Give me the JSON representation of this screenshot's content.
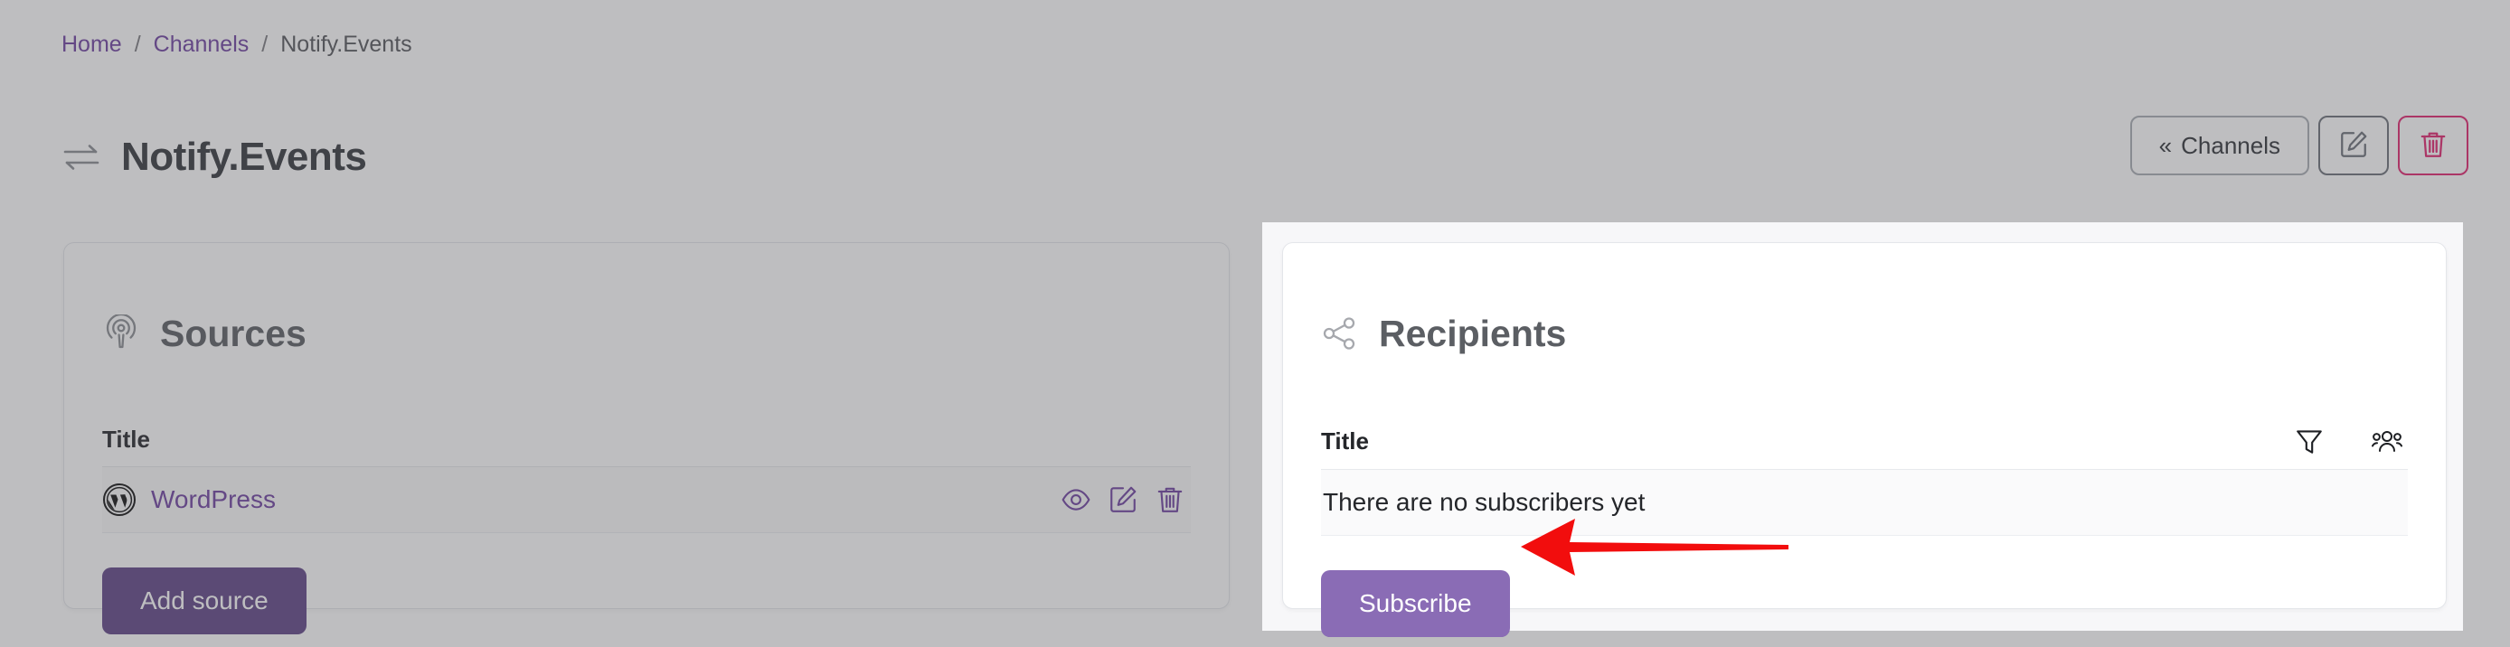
{
  "breadcrumb": {
    "items": [
      {
        "label": "Home",
        "type": "link"
      },
      {
        "label": "Channels",
        "type": "link"
      },
      {
        "label": "Notify.Events",
        "type": "current"
      }
    ],
    "separator": "/"
  },
  "header": {
    "title": "Notify.Events",
    "title_icon": "exchange-arrows-icon",
    "actions": {
      "back_chevron": "«",
      "back_label": "Channels",
      "edit_icon": "edit-square-pencil-icon",
      "delete_icon": "trash-icon"
    }
  },
  "sources_card": {
    "icon": "broadcast-icon",
    "title": "Sources",
    "table": {
      "columns": [
        "Title"
      ],
      "rows": [
        {
          "icon": "wordpress-icon",
          "title": "WordPress",
          "actions": [
            "eye-icon",
            "edit-square-pencil-icon",
            "trash-icon"
          ]
        }
      ]
    },
    "add_button_label": "Add source"
  },
  "recipients_card": {
    "icon": "share-nodes-icon",
    "title": "Recipients",
    "table": {
      "columns": [
        "Title"
      ],
      "header_icons": [
        "filter-funnel-icon",
        "users-group-icon"
      ],
      "empty_text": "There are no subscribers yet"
    },
    "subscribe_button_label": "Subscribe"
  },
  "annotation": {
    "arrow": "left-pointing-arrow",
    "color": "#f20d0d"
  },
  "colors": {
    "accent_purple": "#6f42a1",
    "primary_button": "#5f4487",
    "highlight_button": "#8a6cb5",
    "danger_pink": "#e0246f",
    "dim_overlay": "rgba(85,85,90,0.38)",
    "spotlight_bg": "#f7f7f9"
  }
}
